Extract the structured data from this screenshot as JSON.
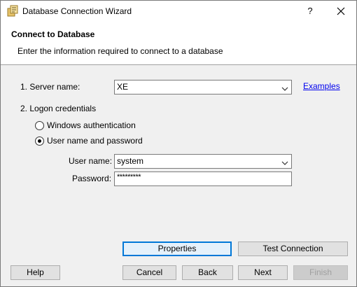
{
  "window": {
    "title": "Database Connection Wizard",
    "help_glyph": "?"
  },
  "header": {
    "title": "Connect to Database",
    "subtitle": "Enter the information required to connect to a database"
  },
  "server": {
    "label": "1. Server name:",
    "value": "XE",
    "examples_link": "Examples"
  },
  "logon": {
    "label": "2. Logon credentials",
    "windows_auth": "Windows authentication",
    "user_pass": "User name and password",
    "selected": "User name and password"
  },
  "username": {
    "label": "User name:",
    "value": "system"
  },
  "password": {
    "label": "Password:",
    "value": "*********"
  },
  "buttons": {
    "properties": "Properties",
    "test_connection": "Test Connection",
    "help": "Help",
    "cancel": "Cancel",
    "back": "Back",
    "next": "Next",
    "finish": "Finish"
  },
  "icons": {
    "app": "database-wizard-icon",
    "close": "close-icon",
    "dropdown": "chevron-down-icon"
  }
}
